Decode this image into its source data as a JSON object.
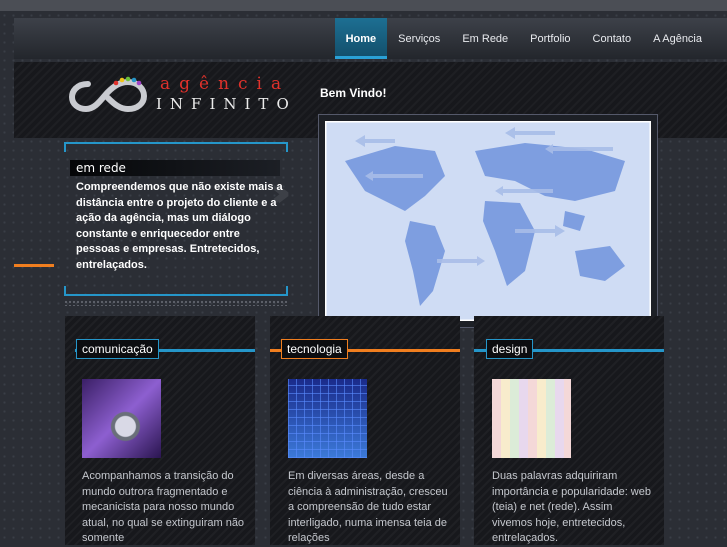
{
  "nav": {
    "items": [
      {
        "label": "Home",
        "active": true
      },
      {
        "label": "Serviços",
        "active": false
      },
      {
        "label": "Em Rede",
        "active": false
      },
      {
        "label": "Portfolio",
        "active": false
      },
      {
        "label": "Contato",
        "active": false
      },
      {
        "label": "A Agência",
        "active": false
      }
    ]
  },
  "logo": {
    "top": "agência",
    "bottom": "INFINITO",
    "symbol": "infinity-icon"
  },
  "header": {
    "welcome": "Bem Vindo!"
  },
  "emrede": {
    "title": "em rede",
    "text": "Compreendemos que não existe mais a distância entre o projeto do cliente e a ação da agência, mas um diálogo constante e enriquecedor entre pessoas e empresas. Entretecidos, entrelaçados."
  },
  "columns": [
    {
      "title": "comunicação",
      "accent": "#2596c9",
      "thumb": "globe-icon",
      "text": "Acompanhamos a transição do mundo outrora fragmentado e mecanicista para nosso mundo atual, no qual se extinguiram não somente"
    },
    {
      "title": "tecnologia",
      "accent": "#f07e1f",
      "thumb": "grid-icon",
      "text": "Em diversas áreas, desde a ciência à administração, cresceu a compreensão de tudo estar interligado, numa imensa teia de relações"
    },
    {
      "title": "design",
      "accent": "#2596c9",
      "thumb": "pattern-icon",
      "text": "Duas palavras adquiriram importância e popularidade: web (teia) e net (rede). Assim vivemos hoje, entretecidos, entrelaçados."
    }
  ],
  "colors": {
    "accent_blue": "#2596c9",
    "accent_orange": "#f07e1f",
    "logo_red": "#e0312b"
  }
}
